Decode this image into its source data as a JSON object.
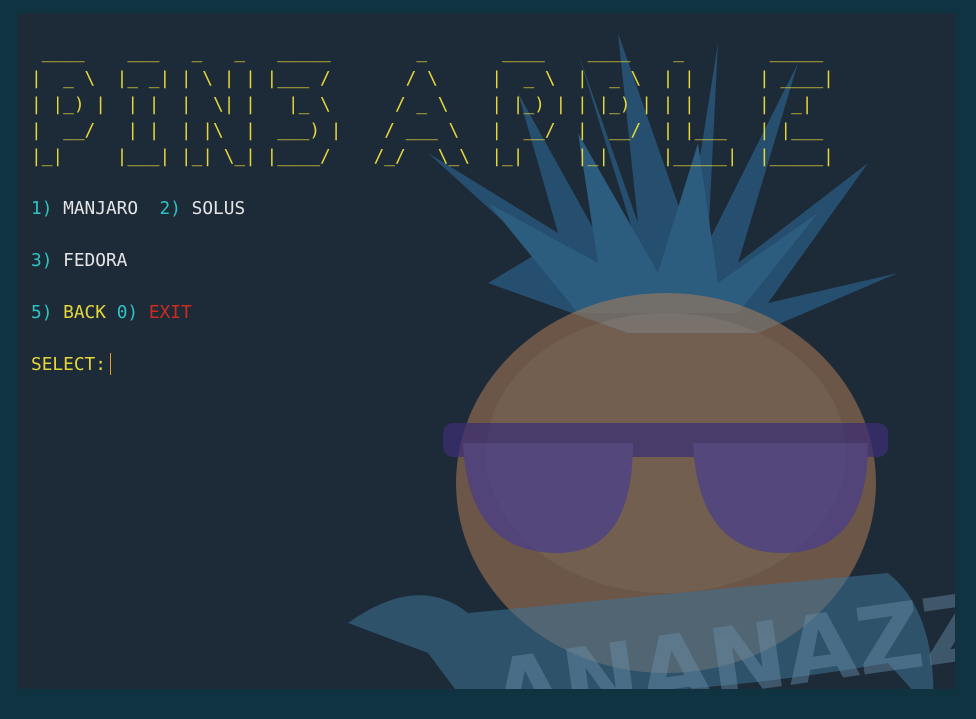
{
  "banner": {
    "ascii_lines": [
      " ____    ___   _   _   _____        _       ____    ____    _        _____",
      "|  _ \\  |_ _| | \\ | | |___ /       / \\     |  _ \\  |  _ \\  | |      | ____|",
      "| |_) |  | |  |  \\| |   |_ \\      / _ \\    | |_) | | |_) | | |      |  _|",
      "|  __/   | |  | |\\  |  ___) |    / ___ \\   |  __/  |  __/  | |___   | |___",
      "|_|     |___| |_| \\_| |____/    /_/   \\_\\  |_|     |_|     |_____|  |_____|"
    ]
  },
  "menu": {
    "opt1_num": "1)",
    "opt1_label": "MANJARO",
    "opt2_num": "2)",
    "opt2_label": "SOLUS",
    "opt3_num": "3)",
    "opt3_label": "FEDORA",
    "opt5_num": "5)",
    "opt5_label": "BACK",
    "opt0_num": "0)",
    "opt0_label": "EXIT"
  },
  "prompt": {
    "label": "SELECT:",
    "value": ""
  },
  "wallpaper": {
    "banner_text": "ANANAZZ",
    "leaf_color": "#2f6e9e",
    "fruit_color": "#b8835a",
    "glasses_color": "#4a3f8a",
    "ribbon_color": "#3d7396"
  }
}
